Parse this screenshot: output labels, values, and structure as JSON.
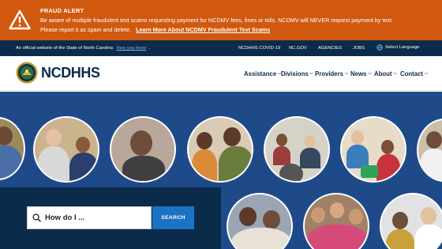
{
  "fraud_alert": {
    "title": "FRAUD ALERT",
    "message": "Be aware of multiple fraudulent text scams requesting payment for NCDMV fees, fines or tolls. NCDMV will NEVER request payment by text. Please report it as spam and delete.",
    "link_label": "Learn More About NCDMV Fraudulent Text Scams",
    "icon": "warning-icon"
  },
  "utility_bar": {
    "official_text": "An official website of the State of North Carolina",
    "how_you_know": "How you know",
    "links": [
      "NCDHHS COVID-19",
      "NC.GOV",
      "AGENCIES",
      "JOBS"
    ],
    "language": "Select Language"
  },
  "header": {
    "logo_text": "NCDHHS",
    "nav": [
      "Assistance",
      "Divisions",
      "Providers",
      "News",
      "About",
      "Contact"
    ]
  },
  "search": {
    "placeholder": "How do I ...",
    "button": "SEARCH"
  },
  "colors": {
    "alert_bg": "#d0590f",
    "navy": "#0b2b4a",
    "hero_blue": "#1f4a8a",
    "button_blue": "#1a73c5"
  }
}
